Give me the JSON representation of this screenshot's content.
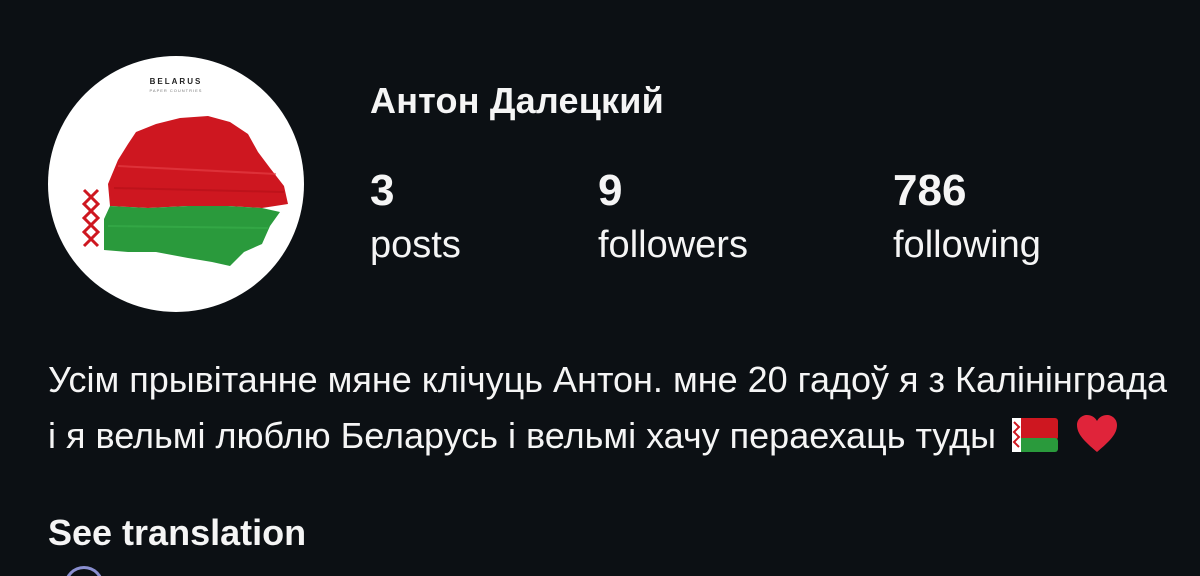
{
  "profile": {
    "username": "Антон Далецкий",
    "avatar_icon": "belarus-map-flag-icon",
    "avatar_caption": "BELARUS",
    "avatar_subcaption": "PAPER COUNTRIES"
  },
  "stats": {
    "posts": {
      "value": "3",
      "label": "posts"
    },
    "followers": {
      "value": "9",
      "label": "followers"
    },
    "following": {
      "value": "786",
      "label": "following"
    }
  },
  "bio": {
    "text": "Усім прывітанне мяне клічуць Антон. мне 20 гадоў я з Калінінграда і я вельмі люблю Беларусь і вельмі хачу пераехаць туды",
    "emojis": [
      "belarus-flag-icon",
      "red-heart-icon"
    ],
    "see_translation": "See translation"
  },
  "colors": {
    "background": "#0c1014",
    "text": "#f5f5f5",
    "flag_red": "#ce1720",
    "flag_green": "#2a9a3c",
    "heart": "#e0243a"
  }
}
